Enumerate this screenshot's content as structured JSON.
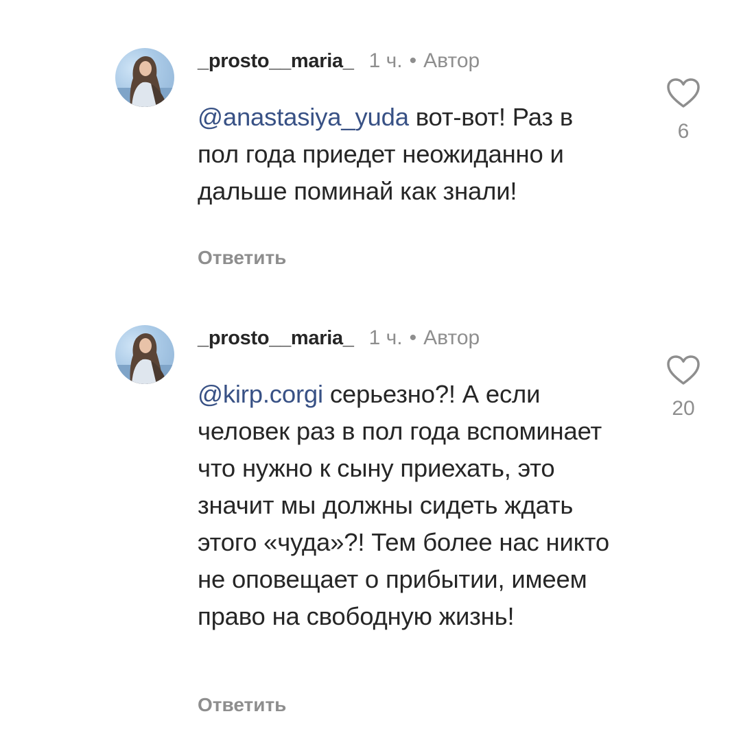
{
  "comments": [
    {
      "username": "_prosto__maria_",
      "time": "1 ч.",
      "separator": "•",
      "badge": "Автор",
      "mention": "@anastasiya_yuda",
      "text": " вот-вот! Раз в пол года приедет неожиданно и дальше поминай как знали!",
      "reply_label": "Ответить",
      "likes": "6",
      "avatar_icon": "profile-photo",
      "like_icon": "heart-icon"
    },
    {
      "username": "_prosto__maria_",
      "time": "1 ч.",
      "separator": "•",
      "badge": "Автор",
      "mention": "@kirp.corgi",
      "text": " серьезно?! А если человек раз в пол года вспоминает что нужно к сыну приехать, это значит мы должны сидеть ждать этого «чуда»?! Тем более нас никто не оповещает о прибытии, имеем право на свободную жизнь!",
      "reply_label": "Ответить",
      "likes": "20",
      "avatar_icon": "profile-photo",
      "like_icon": "heart-icon"
    }
  ],
  "colors": {
    "text": "#262626",
    "secondary": "#8e8e8e",
    "mention": "#385185",
    "background": "#ffffff"
  }
}
